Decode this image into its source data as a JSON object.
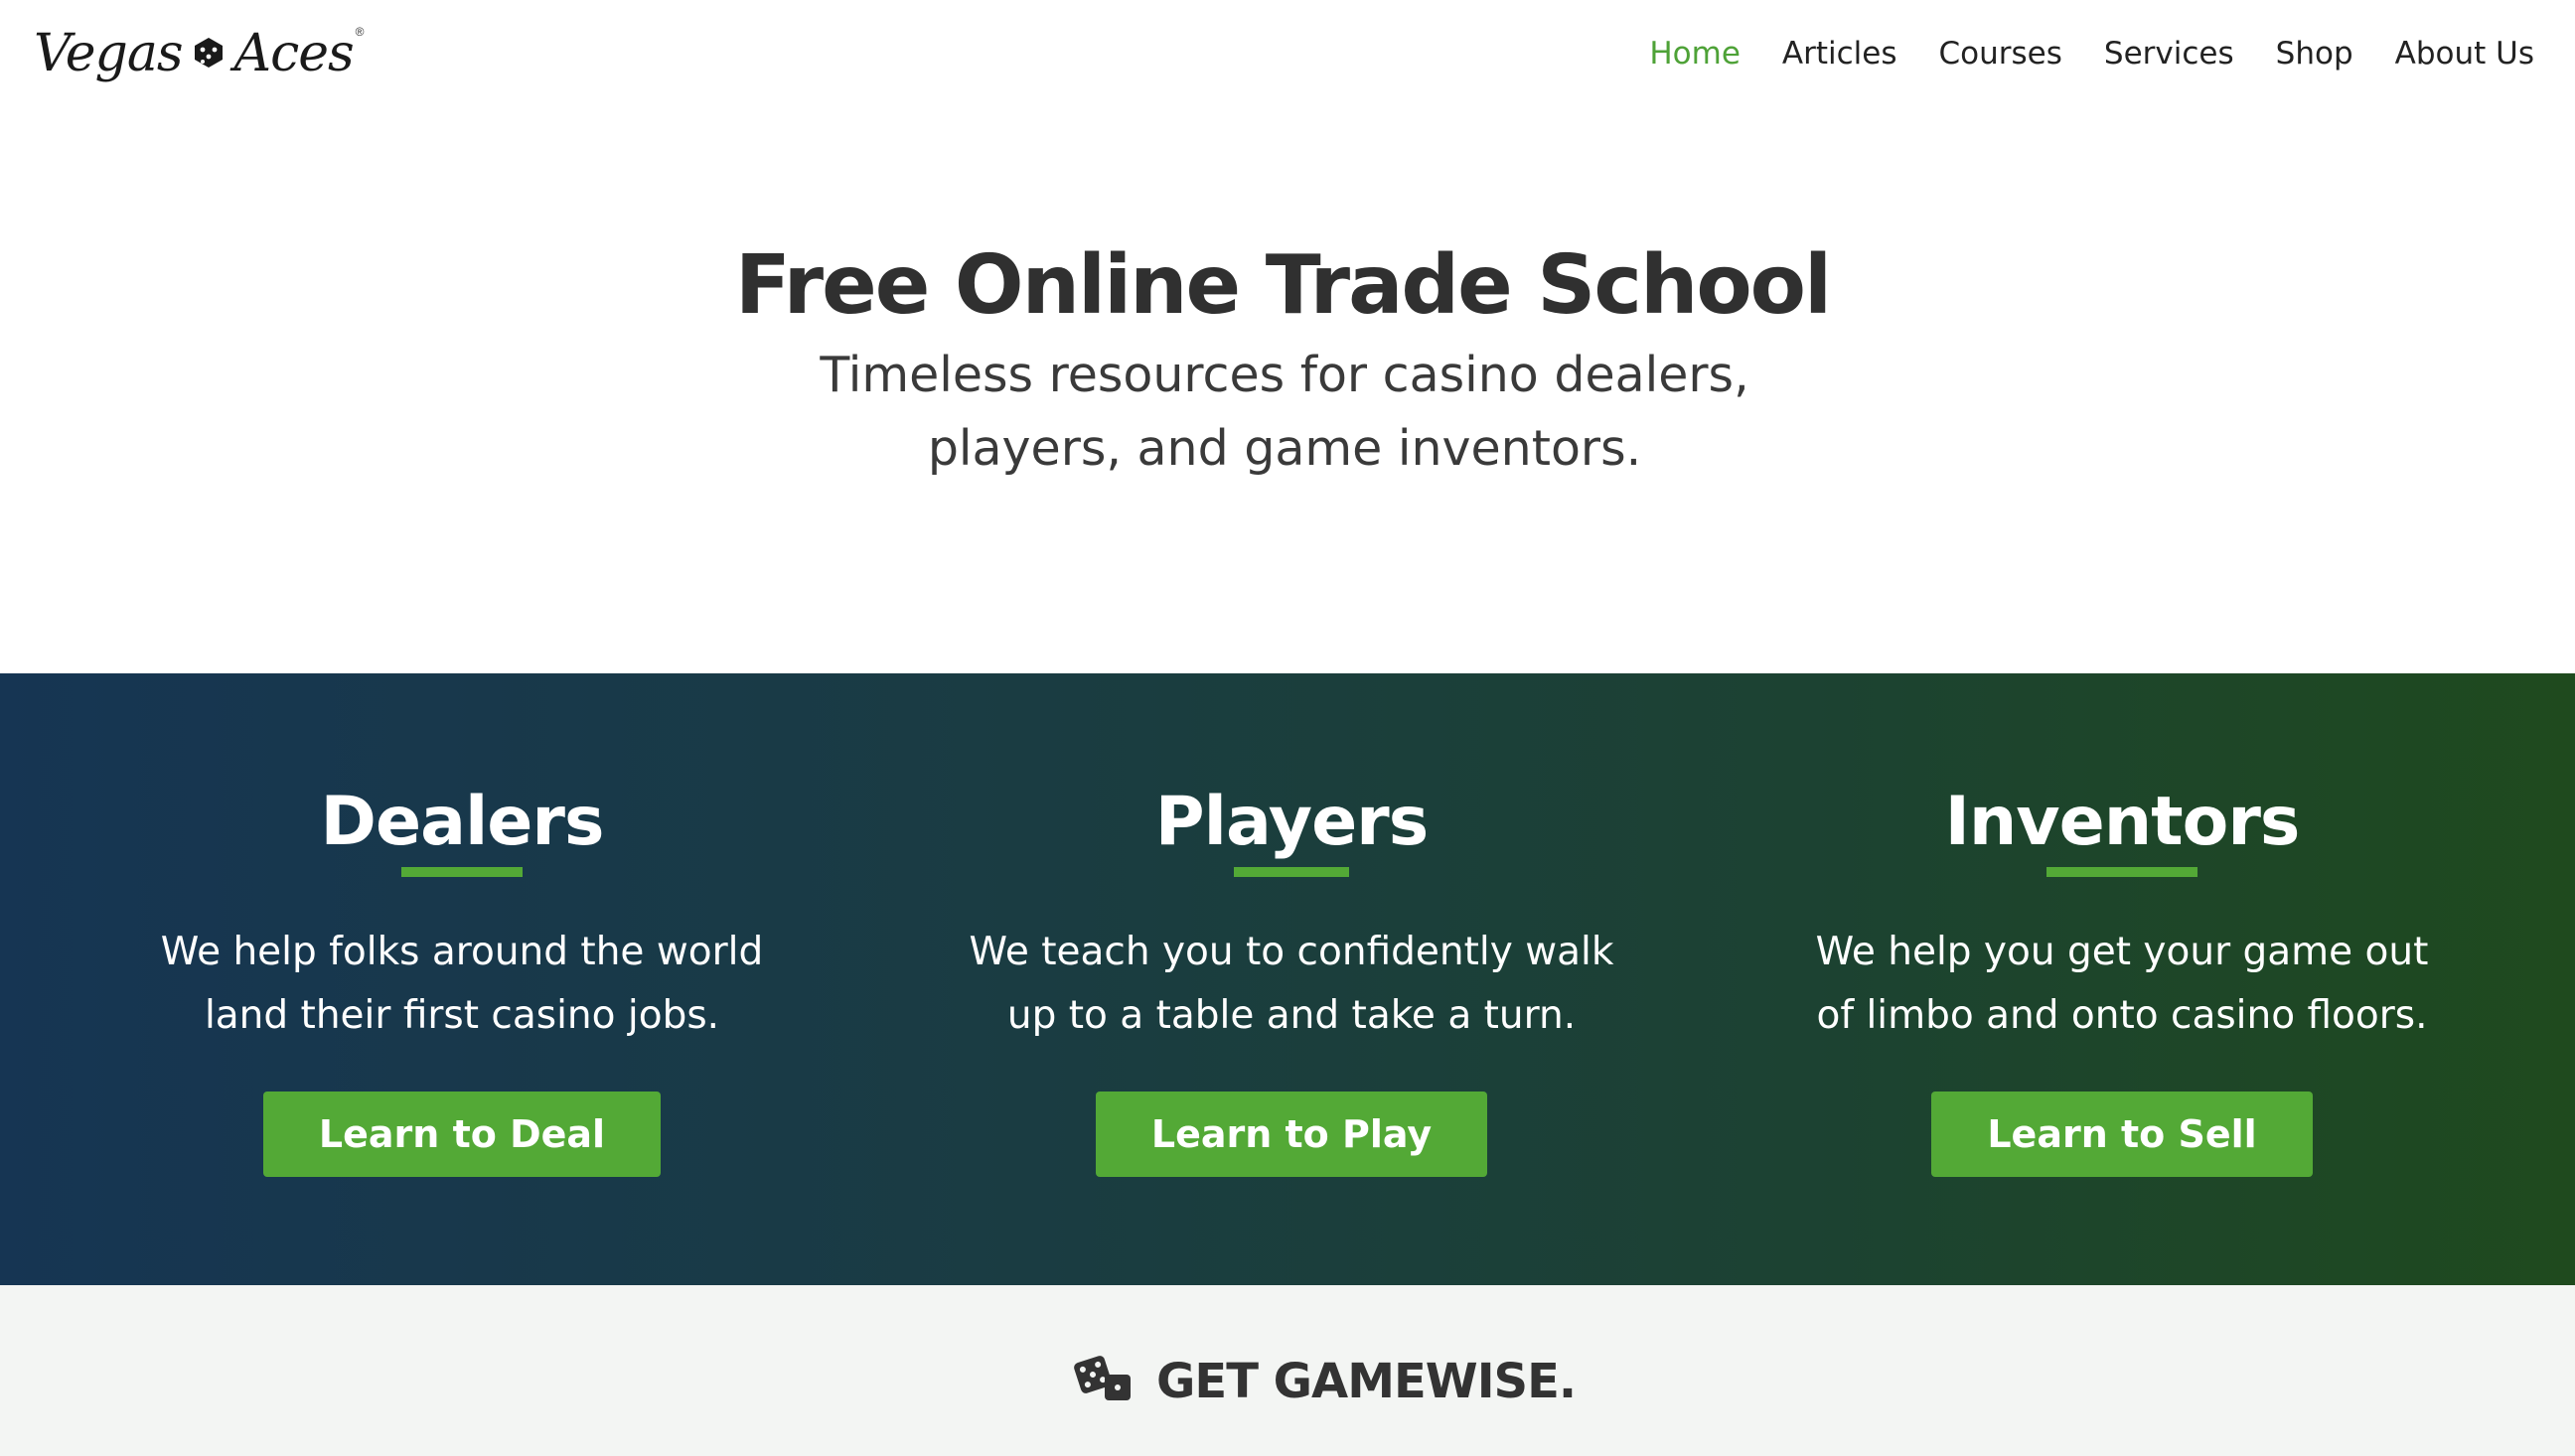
{
  "header": {
    "logo": {
      "left_word": "Vegas",
      "right_word": "Aces",
      "reg_mark": "®"
    },
    "nav": [
      {
        "label": "Home",
        "active": true
      },
      {
        "label": "Articles",
        "active": false
      },
      {
        "label": "Courses",
        "active": false
      },
      {
        "label": "Services",
        "active": false
      },
      {
        "label": "Shop",
        "active": false
      },
      {
        "label": "About Us",
        "active": false
      }
    ]
  },
  "hero": {
    "title": "Free Online Trade School",
    "subtitle": "Timeless resources for casino dealers, players, and game inventors."
  },
  "band": {
    "columns": [
      {
        "title": "Dealers",
        "text": "We help folks around the world land their first casino jobs.",
        "button": "Learn to Deal"
      },
      {
        "title": "Players",
        "text": "We teach you to confidently walk up to a table and take a turn.",
        "button": "Learn to Play"
      },
      {
        "title": "Inventors",
        "text": "We help you get your game out of limbo and onto casino floors.",
        "button": "Learn to Sell"
      }
    ]
  },
  "bottom": {
    "heading": "GET GAMEWISE.",
    "icon": "dice-icon"
  },
  "colors": {
    "accent": "#53a936",
    "nav_active": "#4ea237",
    "band_start": "#163553",
    "band_end": "#1f4a1e",
    "text_dark": "#303030",
    "bottom_bg": "#f3f5f3"
  }
}
